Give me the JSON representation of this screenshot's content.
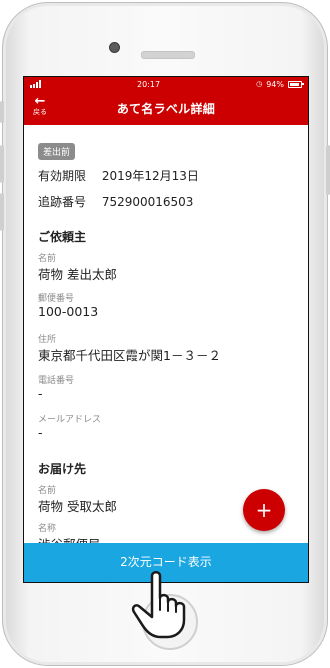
{
  "status_bar": {
    "time": "20:17",
    "battery": "94%"
  },
  "header": {
    "title": "あて名ラベル詳細",
    "back_label": "戻る"
  },
  "badge": "差出前",
  "info": [
    {
      "key": "有効期限",
      "value": "2019年12月13日"
    },
    {
      "key": "追跡番号",
      "value": "752900016503"
    }
  ],
  "sender": {
    "heading": "ご依頼主",
    "fields": [
      {
        "label": "名前",
        "value": "荷物 差出太郎"
      },
      {
        "label": "郵便番号",
        "value": "100-0013"
      },
      {
        "label": "住所",
        "value": "東京都千代田区霞が関1－３－２"
      },
      {
        "label": "電話番号",
        "value": "-"
      },
      {
        "label": "メールアドレス",
        "value": "-"
      }
    ]
  },
  "recipient": {
    "heading": "お届け先",
    "fields": [
      {
        "label": "名前",
        "value": "荷物 受取太郎"
      },
      {
        "label": "名称",
        "value": "渋谷郵便局"
      }
    ]
  },
  "fab_label": "+",
  "bottom_button": "2次元コード表示",
  "icons": {
    "back": "back-arrow-icon",
    "add": "plus-icon",
    "pointer": "tap-hand-icon"
  },
  "colors": {
    "brand": "#cc0000",
    "button": "#1aa6e0"
  }
}
